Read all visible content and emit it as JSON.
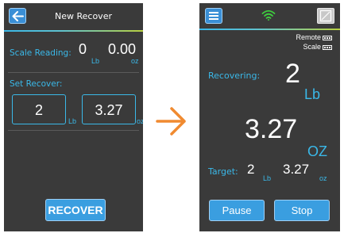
{
  "left": {
    "title": "New Recover",
    "scale_reading_label": "Scale Reading:",
    "scale_lb_value": "0",
    "scale_lb_unit": "Lb",
    "scale_oz_value": "0.00",
    "scale_oz_unit": "oz",
    "set_recover_label": "Set Recover:",
    "set_lb_value": "2",
    "set_lb_unit": "Lb",
    "set_oz_value": "3.27",
    "set_oz_unit": "oz",
    "recover_button": "RECOVER"
  },
  "right": {
    "remote_label": "Remote",
    "scale_label": "Scale",
    "recovering_label": "Recovering:",
    "recovering_lb_value": "2",
    "recovering_lb_unit": "Lb",
    "recovering_oz_value": "3.27",
    "recovering_oz_unit": "OZ",
    "target_label": "Target:",
    "target_lb_value": "2",
    "target_lb_unit": "Lb",
    "target_oz_value": "3.27",
    "target_oz_unit": "oz",
    "pause_button": "Pause",
    "stop_button": "Stop"
  },
  "colors": {
    "accent_blue": "#3ab8e8",
    "button_blue": "#3a9ee0",
    "arrow_orange": "#f08a30",
    "wifi_green": "#3ecf3e",
    "screen_bg": "#3a3a3a"
  },
  "icons": {
    "back": "back-arrow-icon",
    "menu": "menu-icon",
    "wifi": "wifi-icon",
    "scale": "scale-icon",
    "battery": "battery-icon",
    "transition": "right-arrow-icon"
  }
}
